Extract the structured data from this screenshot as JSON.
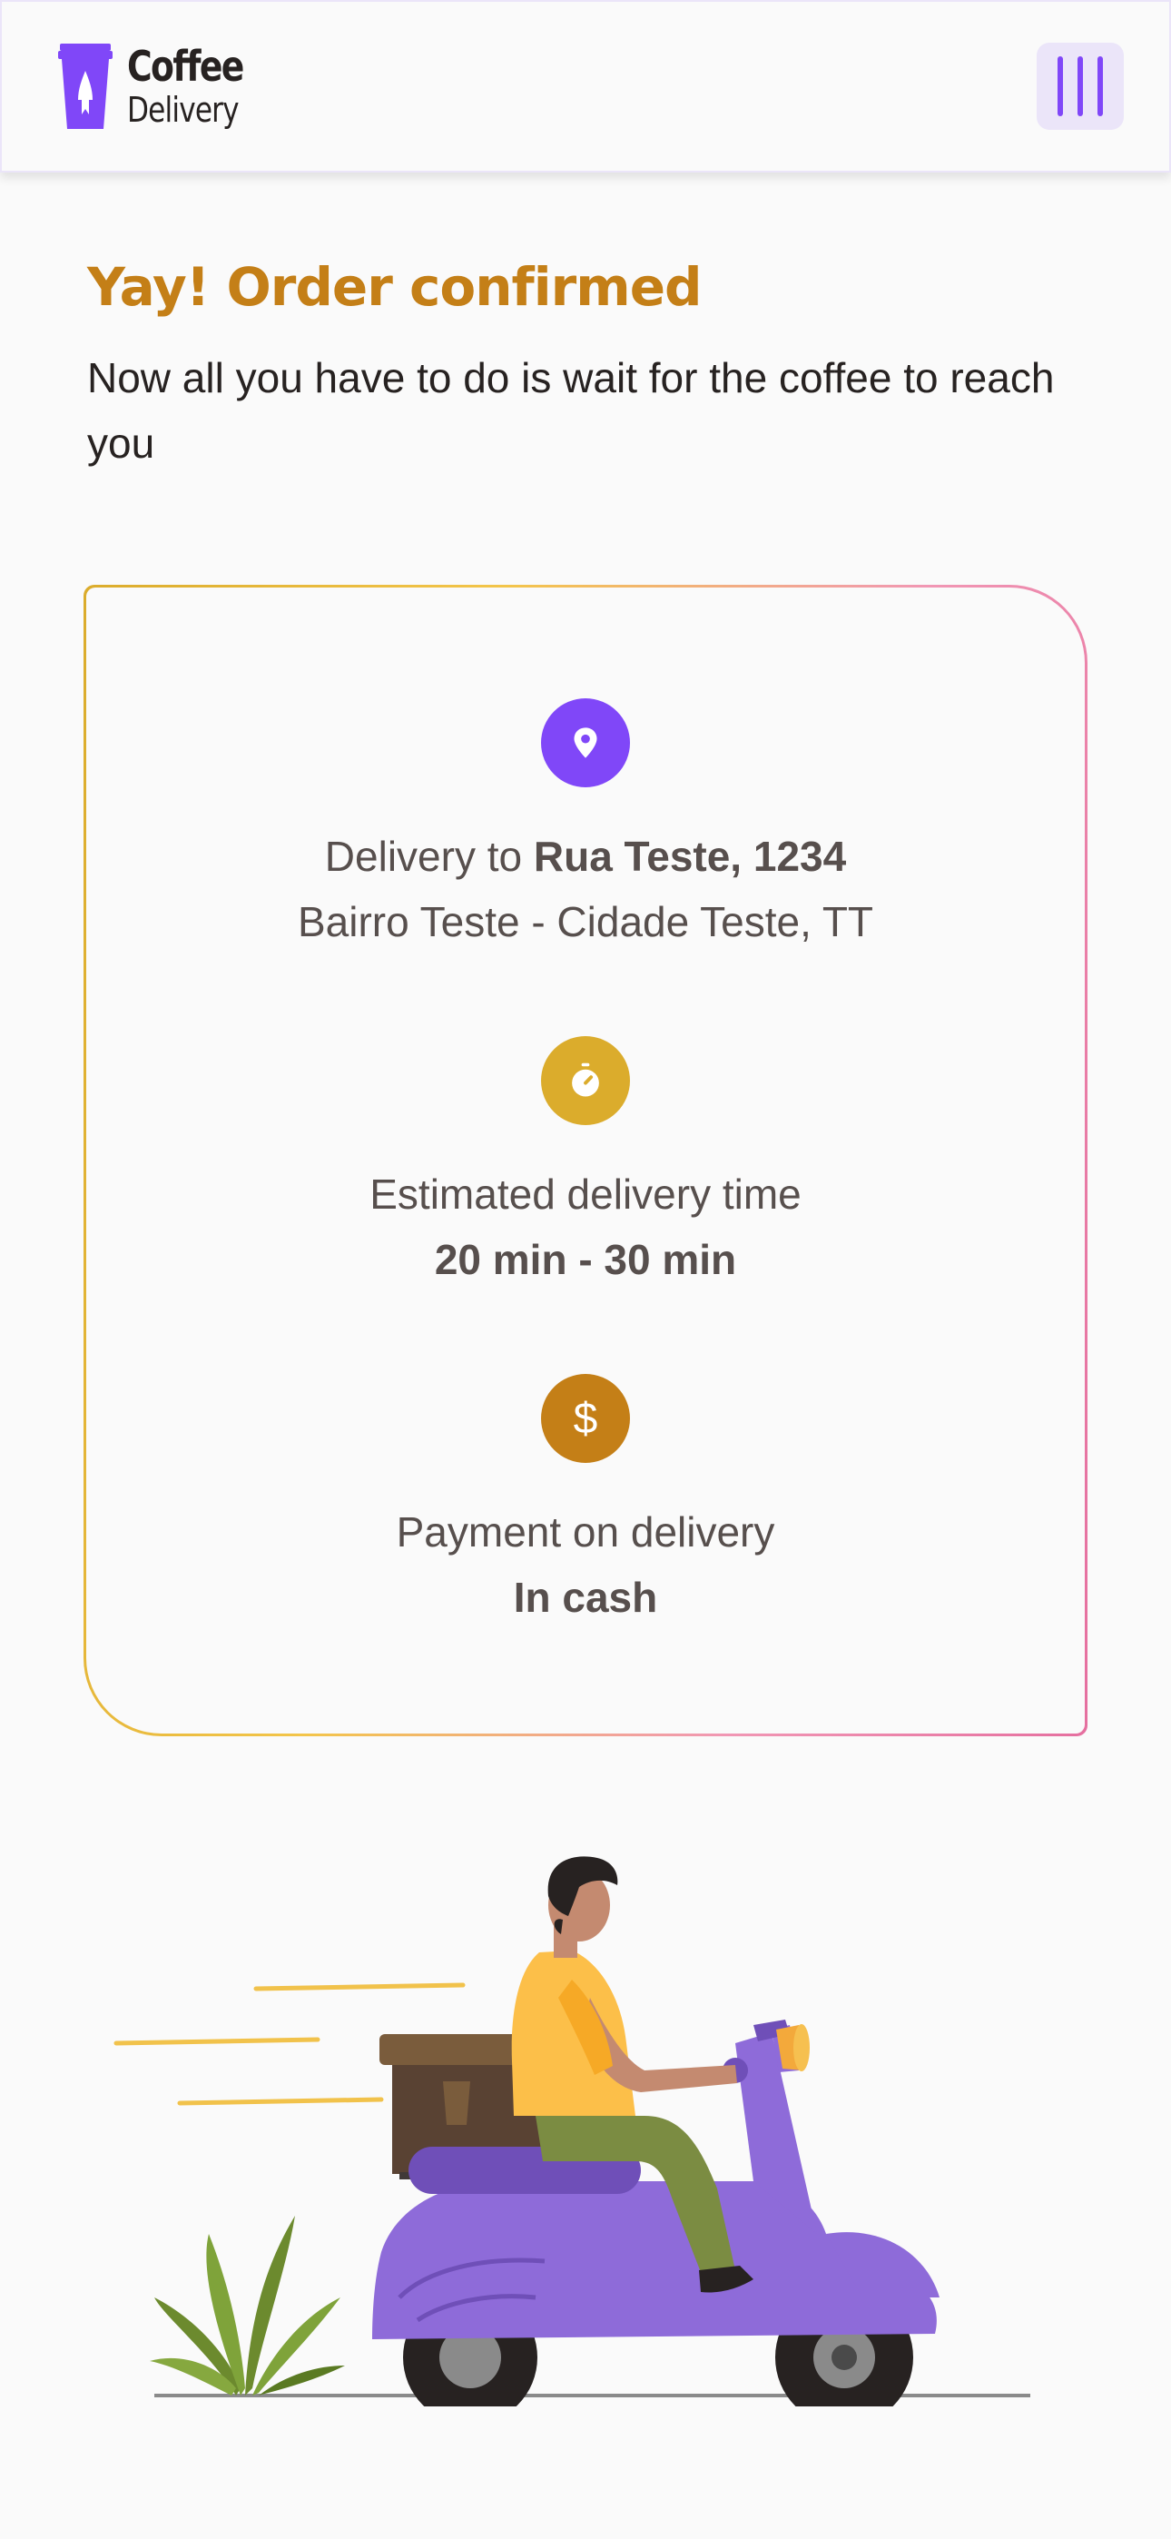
{
  "header": {
    "logo_title": "Coffee",
    "logo_subtitle": "Delivery",
    "menu_icon": "menu-bars-icon"
  },
  "confirmation": {
    "title": "Yay! Order confirmed",
    "subtitle": "Now all you have to do is wait for the coffee to reach you"
  },
  "details": {
    "delivery": {
      "icon": "map-pin-icon",
      "prefix": "Delivery to ",
      "address": "Rua Teste, 1234",
      "area": "Bairro Teste - Cidade Teste, TT"
    },
    "time": {
      "icon": "timer-icon",
      "label": "Estimated delivery time",
      "value": "20 min - 30 min"
    },
    "payment": {
      "icon": "dollar-icon",
      "label": "Payment on delivery",
      "value": "In cash"
    }
  },
  "colors": {
    "brand_purple": "#8047f8",
    "brand_yellow": "#c47f17",
    "yellow_icon": "#dbac2c",
    "text": "#574f4d",
    "background": "#fafafa"
  },
  "illustration": {
    "icon": "delivery-scooter-illustration"
  }
}
